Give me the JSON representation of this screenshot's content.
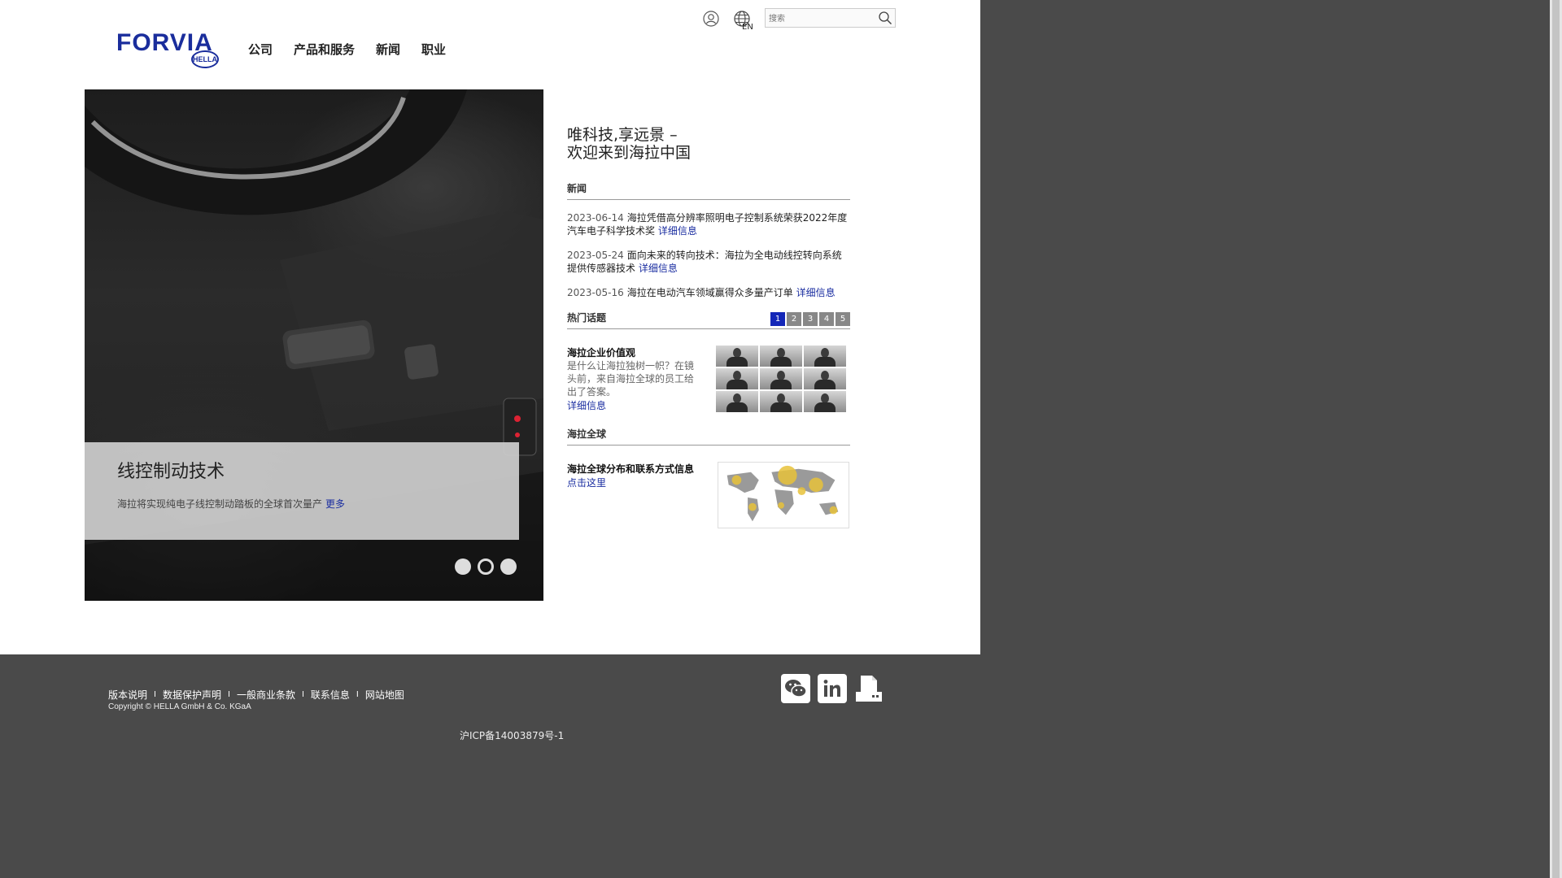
{
  "header": {
    "logo_text": "FORVIA",
    "logo_sub": "HELLA",
    "nav": [
      "公司",
      "产品和服务",
      "新闻",
      "职业"
    ],
    "lang": "EN",
    "search_placeholder": "搜索"
  },
  "hero": {
    "title": "线控制动技术",
    "text": "海拉将实现纯电子线控制动踏板的全球首次量产",
    "more": "更多",
    "slides": 3,
    "active_slide": 2
  },
  "main": {
    "welcome_line1": "唯科技,享远景 –",
    "welcome_line2": "欢迎来到海拉中国",
    "news_title": "新闻",
    "news": [
      {
        "date": "2023-06-14",
        "text": "海拉凭借高分辨率照明电子控制系统荣获2022年度汽车电子科学技术奖",
        "link": "详细信息"
      },
      {
        "date": "2023-05-24",
        "text": "面向未来的转向技术：海拉为全电动线控转向系统提供传感器技术",
        "link": "详细信息"
      },
      {
        "date": "2023-05-16",
        "text": "海拉在电动汽车领域赢得众多量产订单",
        "link": "详细信息"
      }
    ],
    "hot_title": "热门话题",
    "pages": [
      "1",
      "2",
      "3",
      "4",
      "5"
    ],
    "active_page": "1",
    "topic": {
      "title": "海拉企业价值观",
      "text": "是什么让海拉独树一帜？在镜头前，来自海拉全球的员工给出了答案。",
      "link": "详细信息"
    },
    "global_title": "海拉全球",
    "global": {
      "title": "海拉全球分布和联系方式信息",
      "link": "点击这里"
    }
  },
  "footer": {
    "links": [
      "版本说明",
      "数据保护声明",
      "一般商业条款",
      "联系信息",
      "网站地图"
    ],
    "copyright": "Copyright © HELLA GmbH & Co. KGaA",
    "icp": "沪ICP备14003879号-1",
    "social": [
      "wechat-icon",
      "linkedin-icon",
      "print-icon"
    ]
  },
  "colors": {
    "brand_blue": "#1a2d9c",
    "link_blue": "#1a2da0",
    "footer_bg": "#4a4a4a"
  }
}
